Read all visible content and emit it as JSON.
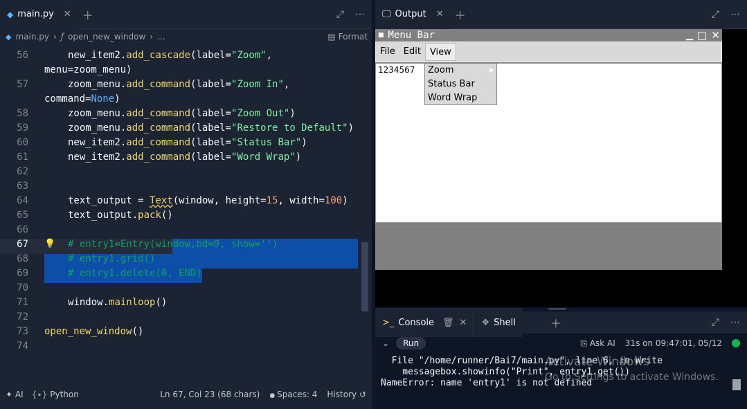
{
  "editor": {
    "tab_label": "main.py",
    "breadcrumb": {
      "file": "main.py",
      "func": "open_new_window",
      "more": "...",
      "format": "Format"
    },
    "lines": [
      {
        "n": "56"
      },
      {
        "n": "57"
      },
      {
        "n": "58"
      },
      {
        "n": "59"
      },
      {
        "n": "60"
      },
      {
        "n": "61"
      },
      {
        "n": "62"
      },
      {
        "n": "63"
      },
      {
        "n": "64"
      },
      {
        "n": "65"
      },
      {
        "n": "66"
      },
      {
        "n": "67"
      },
      {
        "n": "68"
      },
      {
        "n": "69"
      },
      {
        "n": "70"
      },
      {
        "n": "71"
      },
      {
        "n": "72"
      },
      {
        "n": "73"
      },
      {
        "n": "74"
      }
    ],
    "code": {
      "l56a_obj": "new_item2.",
      "l56a_fn": "add_cascade",
      "l56a_rest1": "(label=",
      "l56a_str": "\"Zoom\"",
      "l56a_rest2": ",",
      "l56b": "menu=zoom_menu)",
      "l57a_obj": "zoom_menu.",
      "l57a_fn": "add_command",
      "l57a_rest1": "(label=",
      "l57a_str": "\"Zoom In\"",
      "l57a_rest2": ",",
      "l57b_pre": "command=",
      "l57b_kw": "None",
      "l57b_post": ")",
      "l58_obj": "zoom_menu.",
      "l58_fn": "add_command",
      "l58_rest1": "(label=",
      "l58_str": "\"Zoom Out\"",
      "l58_rest2": ")",
      "l59_obj": "zoom_menu.",
      "l59_fn": "add_command",
      "l59_rest1": "(label=",
      "l59_str": "\"Restore to Default\"",
      "l59_rest2": ")",
      "l60_obj": "new_item2.",
      "l60_fn": "add_command",
      "l60_rest1": "(label=",
      "l60_str": "\"Status Bar\"",
      "l60_rest2": ")",
      "l61_obj": "new_item2.",
      "l61_fn": "add_command",
      "l61_rest1": "(label=",
      "l61_str": "\"Word Wrap\"",
      "l61_rest2": ")",
      "l64_a": "text_output = ",
      "l64_cls": "Text",
      "l64_b": "(window, height=",
      "l64_n1": "15",
      "l64_c": ", width=",
      "l64_n2": "100",
      "l64_d": ")",
      "l65_obj": "text_output.",
      "l65_fn": "pack",
      "l65_rest": "()",
      "l67": "# entry1=Entry(window,bd=0, show='')",
      "l68": "# entry1.grid()",
      "l69": "# entry1.delete(0, END)",
      "l71_obj": "window.",
      "l71_fn": "mainloop",
      "l71_rest": "()",
      "l73_fn": "open_new_window",
      "l73_rest": "()"
    },
    "status": {
      "ai": "AI",
      "lang": "Python",
      "pos": "Ln 67, Col 23 (68 chars)",
      "spaces": "Spaces: 4",
      "history": "History"
    }
  },
  "output": {
    "tab_label": "Output",
    "tk": {
      "title": "Menu Bar",
      "menus": [
        "File",
        "Edit",
        "View"
      ],
      "text_content": "1234567",
      "dropdown": [
        "Zoom",
        "Status Bar",
        "Word Wrap"
      ]
    }
  },
  "console": {
    "tab_console": "Console",
    "tab_shell": "Shell",
    "run": "Run",
    "ask_ai": "Ask AI",
    "run_info": "31s on 09:47:01, 05/12",
    "output_lines": [
      "  File \"/home/runner/Bai7/main.py\", line 6, in Write",
      "    messagebox.showinfo(\"Print\", entry1.get())",
      "NameError: name 'entry1' is not defined"
    ],
    "watermark_line1": "Activate Windows",
    "watermark_line2": "Go to Settings to activate Windows."
  },
  "colors": {
    "bg": "#1c2333",
    "accent": "#0d4fa8",
    "run_ok": "#0cb84d"
  },
  "icons": [
    "python-icon",
    "close-icon",
    "plus-icon",
    "expand-icon",
    "more-icon",
    "function-icon",
    "format-icon",
    "monitor-icon",
    "lightbulb-icon",
    "trash-icon",
    "shell-icon",
    "chevron-down-icon",
    "ask-ai-icon",
    "history-icon"
  ]
}
